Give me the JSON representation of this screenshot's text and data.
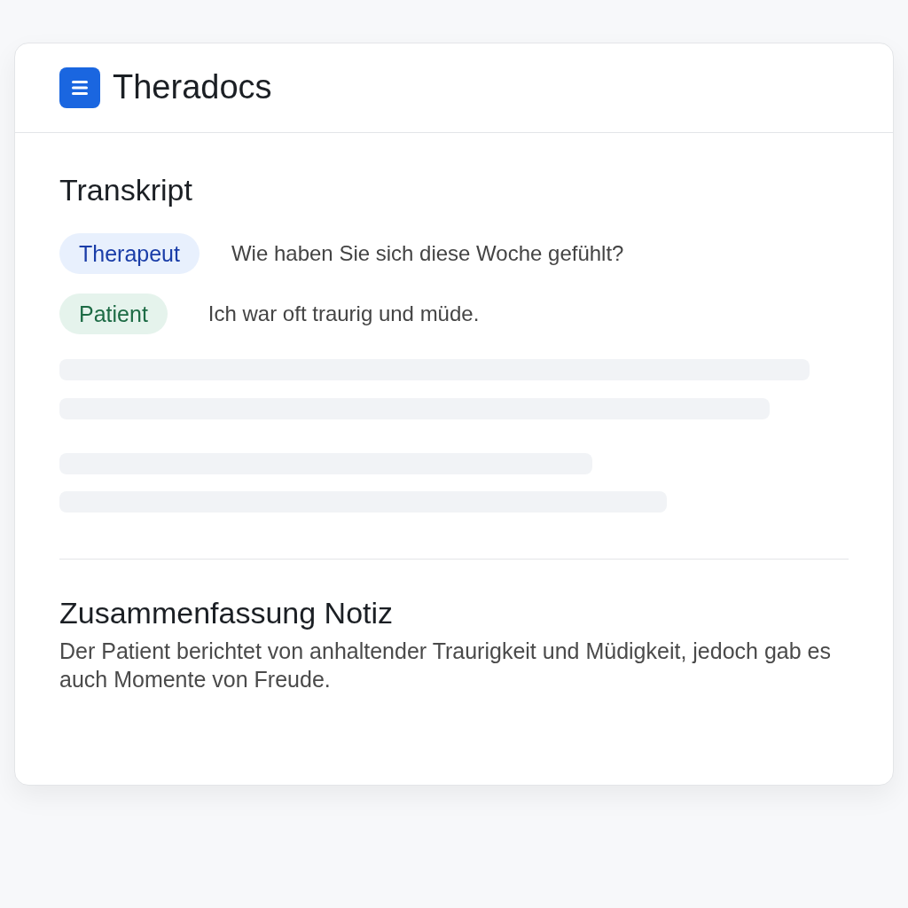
{
  "app": {
    "title": "Theradocs"
  },
  "transcript": {
    "title": "Transkript",
    "lines": [
      {
        "speaker": "Therapeut",
        "kind": "therapist",
        "text": "Wie haben Sie sich diese Woche gefühlt?"
      },
      {
        "speaker": "Patient",
        "kind": "patient",
        "text": "Ich war oft traurig und müde."
      }
    ]
  },
  "summary": {
    "title": "Zusammenfassung Notiz",
    "text": "Der Patient berichtet von anhaltender Traurigkeit und Müdigkeit, jedoch gab es auch Momente von Freude."
  }
}
